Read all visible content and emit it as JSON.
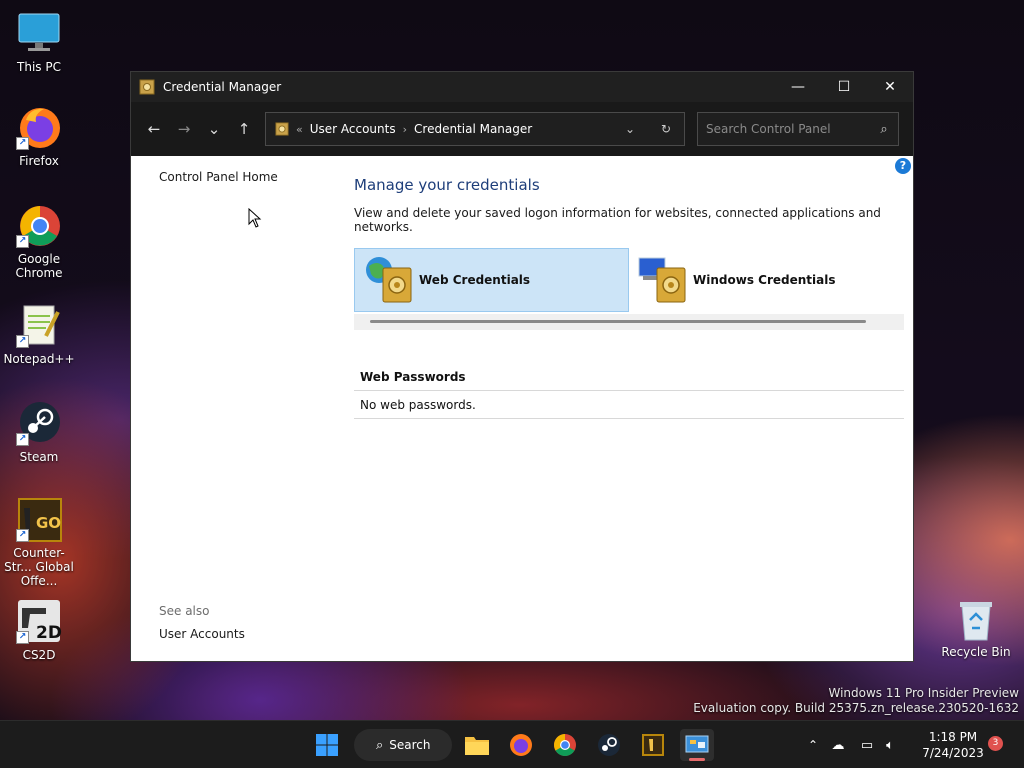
{
  "desktop": {
    "icons": [
      {
        "label": "This PC"
      },
      {
        "label": "Firefox"
      },
      {
        "label": "Google Chrome"
      },
      {
        "label": "Notepad++"
      },
      {
        "label": "Steam"
      },
      {
        "label": "Counter-Str... Global Offe..."
      },
      {
        "label": "CS2D"
      }
    ],
    "recycle_bin": "Recycle Bin",
    "watermark_line1": "Windows 11 Pro Insider Preview",
    "watermark_line2": "Evaluation copy. Build 25375.zn_release.230520-1632"
  },
  "window": {
    "title": "Credential Manager",
    "controls": {
      "minimize": "—",
      "maximize": "☐",
      "close": "✕"
    },
    "breadcrumb": {
      "overflow": "«",
      "items": [
        "User Accounts",
        "Credential Manager"
      ],
      "separator": "›"
    },
    "search": {
      "placeholder": "Search Control Panel"
    },
    "left_pane": {
      "home_link": "Control Panel Home",
      "see_also": "See also",
      "see_also_link": "User Accounts"
    },
    "main": {
      "heading": "Manage your credentials",
      "description": "View and delete your saved logon information for websites, connected applications and networks.",
      "tiles": [
        {
          "label": "Web Credentials",
          "selected": true
        },
        {
          "label": "Windows Credentials",
          "selected": false
        }
      ],
      "section_title": "Web Passwords",
      "section_body": "No web passwords."
    },
    "help": "?"
  },
  "taskbar": {
    "search_label": "Search",
    "time": "1:18 PM",
    "date": "7/24/2023",
    "notification_count": "3"
  }
}
